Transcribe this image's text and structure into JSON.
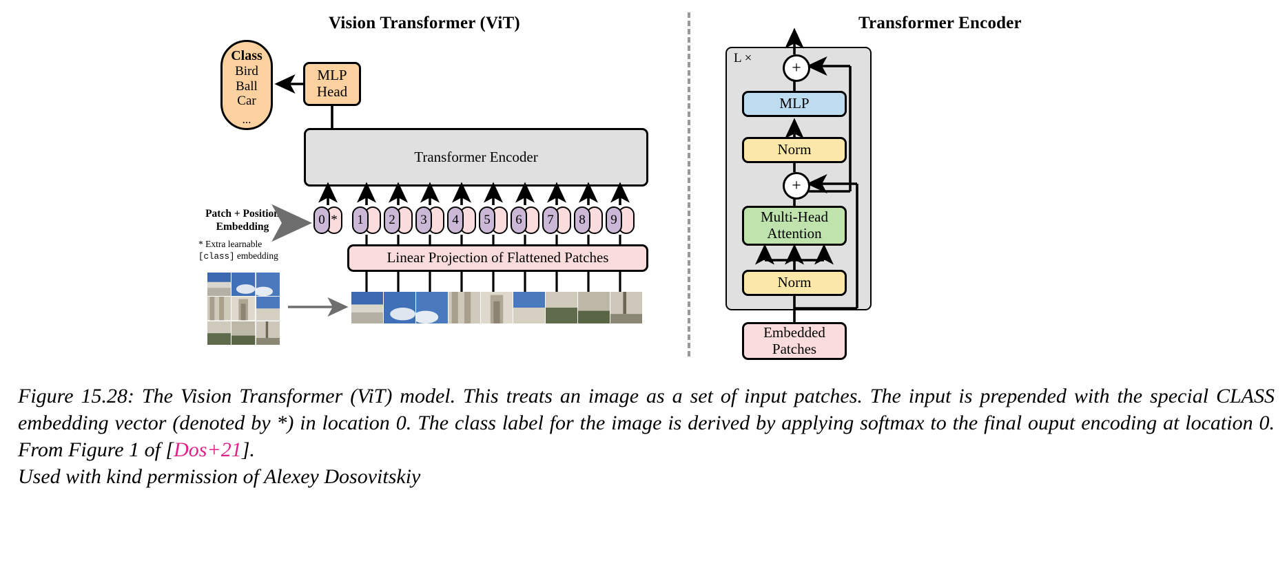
{
  "figure": {
    "left_panel_title": "Vision Transformer (ViT)",
    "right_panel_title": "Transformer Encoder"
  },
  "left_panel": {
    "class_head": "Class",
    "class_labels": [
      "Bird",
      "Ball",
      "Car"
    ],
    "class_ellipsis": "...",
    "mlp_head_line1": "MLP",
    "mlp_head_line2": "Head",
    "encoder_bar_label": "Transformer Encoder",
    "patch_position_label_line1": "Patch + Position",
    "patch_position_label_line2": "Embedding",
    "extra_learnable_line1": "* Extra learnable",
    "extra_learnable_mono": "[class]",
    "extra_learnable_tail": " embedding",
    "linear_projection_label": "Linear Projection of Flattened Patches",
    "tokens": [
      {
        "position": "0",
        "patch": "*"
      },
      {
        "position": "1",
        "patch": ""
      },
      {
        "position": "2",
        "patch": ""
      },
      {
        "position": "3",
        "patch": ""
      },
      {
        "position": "4",
        "patch": ""
      },
      {
        "position": "5",
        "patch": ""
      },
      {
        "position": "6",
        "patch": ""
      },
      {
        "position": "7",
        "patch": ""
      },
      {
        "position": "8",
        "patch": ""
      },
      {
        "position": "9",
        "patch": ""
      }
    ]
  },
  "right_panel": {
    "repeat_label": "L ×",
    "mlp_label": "MLP",
    "norm_top_label": "Norm",
    "mha_line1": "Multi-Head",
    "mha_line2": "Attention",
    "norm_bottom_label": "Norm",
    "embedded_line1": "Embedded",
    "embedded_line2": "Patches",
    "plus_symbol": "+"
  },
  "caption": {
    "text_part1": "Figure 15.28: The Vision Transformer (ViT) model. This treats an image as a set of input patches. The input is prepended with the special CLASS embedding vector (denoted by *) in location 0. The class label for the image is derived by applying softmax to the final ouput encoding at location 0. From Figure 1 of [",
    "citation": "Dos+21",
    "text_part2": "]. ",
    "last_line": "Used with kind permission of Alexey Dosovitskiy"
  },
  "colors": {
    "orange": "#fbd1a0",
    "grey_box": "#e0e0e0",
    "pink": "#fadcdc",
    "purple": "#cbb8d6",
    "blue": "#bedcf0",
    "yellow": "#fbe7a8",
    "green": "#bfe3ad",
    "citation_pink": "#e0218a",
    "divider_grey": "#9a9a9a"
  }
}
